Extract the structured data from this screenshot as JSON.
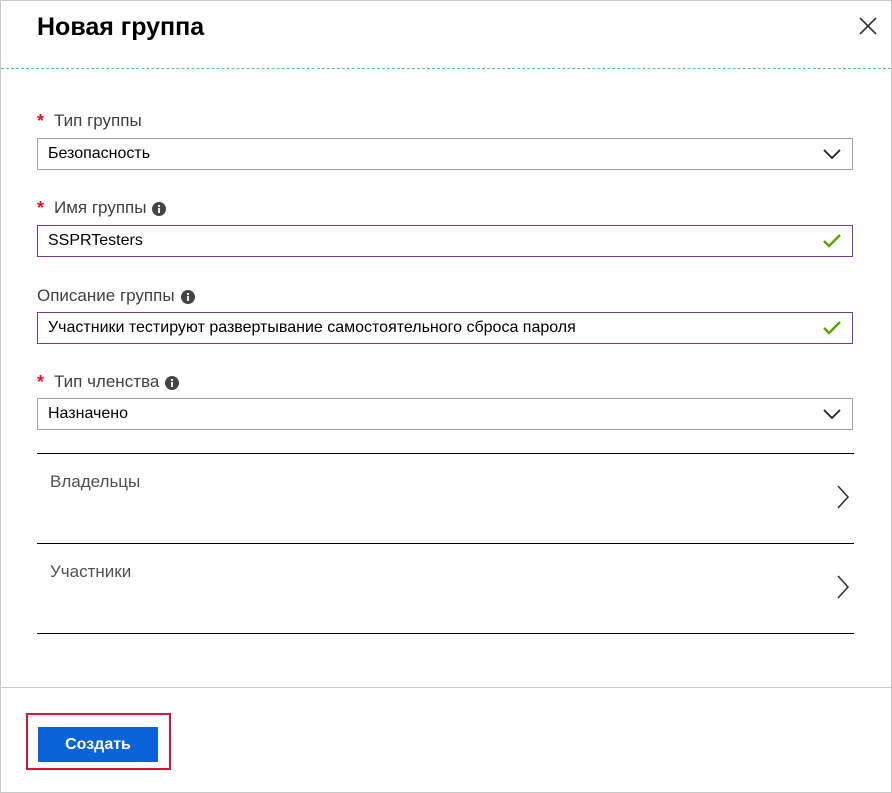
{
  "dialog": {
    "title": "Новая группа"
  },
  "fields": {
    "group_type": {
      "label": "Тип группы",
      "required": "*",
      "value": "Безопасность"
    },
    "group_name": {
      "label": "Имя группы",
      "required": "*",
      "value": "SSPRTesters"
    },
    "group_description": {
      "label": "Описание группы",
      "value": "Участники тестируют развертывание самостоятельного сброса пароля"
    },
    "membership_type": {
      "label": "Тип членства",
      "required": "*",
      "value": "Назначено"
    }
  },
  "nav_items": {
    "owners": {
      "label": "Владельцы"
    },
    "members": {
      "label": "Участники"
    }
  },
  "footer": {
    "create_label": "Создать"
  },
  "colors": {
    "accent_button": "#0a63d8",
    "required_star": "#e81123",
    "valid_check": "#57a300",
    "valid_border": "#7a3a8a",
    "highlight": "#d9153a"
  },
  "icons": {
    "close": "close-icon",
    "chevron_down": "chevron-down-icon",
    "chevron_right": "chevron-right-icon",
    "info": "info-icon",
    "check": "check-icon"
  }
}
